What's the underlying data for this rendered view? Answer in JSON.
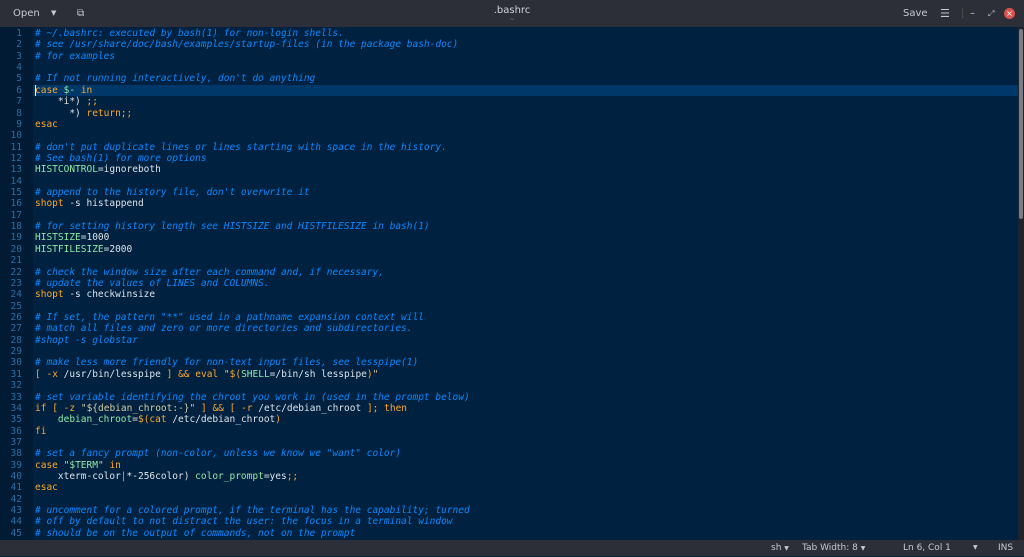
{
  "header": {
    "open_label": "Open",
    "title": ".bashrc",
    "subtitle": "~",
    "save_label": "Save"
  },
  "status": {
    "language": "sh",
    "tab_width": "Tab Width: 8",
    "position": "Ln 6, Col 1",
    "mode": "INS"
  },
  "editor": {
    "current_line": 6,
    "lines": [
      [
        [
          "c",
          "# ~/.bashrc: executed by bash(1) for non-login shells."
        ]
      ],
      [
        [
          "c",
          "# see /usr/share/doc/bash/examples/startup-files (in the package bash-doc)"
        ]
      ],
      [
        [
          "c",
          "# for examples"
        ]
      ],
      [],
      [
        [
          "c",
          "# If not running interactively, don't do anything"
        ]
      ],
      [
        [
          "k",
          "case"
        ],
        [
          "t",
          " "
        ],
        [
          "v",
          "$-"
        ],
        [
          "t",
          " "
        ],
        [
          "k",
          "in"
        ]
      ],
      [
        [
          "t",
          "    *i*) "
        ],
        [
          "k",
          ";;"
        ]
      ],
      [
        [
          "t",
          "      *) "
        ],
        [
          "k",
          "return;;"
        ]
      ],
      [
        [
          "k",
          "esac"
        ]
      ],
      [],
      [
        [
          "c",
          "# don't put duplicate lines or lines starting with space in the history."
        ]
      ],
      [
        [
          "c",
          "# See bash(1) for more options"
        ]
      ],
      [
        [
          "v",
          "HISTCONTROL"
        ],
        [
          "t",
          "=ignoreboth"
        ]
      ],
      [],
      [
        [
          "c",
          "# append to the history file, don't overwrite it"
        ]
      ],
      [
        [
          "k",
          "shopt"
        ],
        [
          "t",
          " -s histappend"
        ]
      ],
      [],
      [
        [
          "c",
          "# for setting history length see HISTSIZE and HISTFILESIZE in bash(1)"
        ]
      ],
      [
        [
          "v",
          "HISTSIZE"
        ],
        [
          "t",
          "=1000"
        ]
      ],
      [
        [
          "v",
          "HISTFILESIZE"
        ],
        [
          "t",
          "=2000"
        ]
      ],
      [],
      [
        [
          "c",
          "# check the window size after each command and, if necessary,"
        ]
      ],
      [
        [
          "c",
          "# update the values of LINES and COLUMNS."
        ]
      ],
      [
        [
          "k",
          "shopt"
        ],
        [
          "t",
          " -s checkwinsize"
        ]
      ],
      [],
      [
        [
          "c",
          "# If set, the pattern \"**\" used in a pathname expansion context will"
        ]
      ],
      [
        [
          "c",
          "# match all files and zero or more directories and subdirectories."
        ]
      ],
      [
        [
          "c",
          "#shopt -s globstar"
        ]
      ],
      [],
      [
        [
          "c",
          "# make less more friendly for non-text input files, see lesspipe(1)"
        ]
      ],
      [
        [
          "k",
          "["
        ],
        [
          "t",
          " "
        ],
        [
          "k",
          "-x"
        ],
        [
          "t",
          " /usr/bin/lesspipe "
        ],
        [
          "k",
          "]"
        ],
        [
          "t",
          " "
        ],
        [
          "k",
          "&&"
        ],
        [
          "t",
          " "
        ],
        [
          "k",
          "eval"
        ],
        [
          "t",
          " "
        ],
        [
          "s",
          "\""
        ],
        [
          "k",
          "$("
        ],
        [
          "v",
          "SHELL"
        ],
        [
          "t",
          "=/bin/sh lesspipe"
        ],
        [
          "k",
          ")"
        ],
        [
          "s",
          "\""
        ]
      ],
      [],
      [
        [
          "c",
          "# set variable identifying the chroot you work in (used in the prompt below)"
        ]
      ],
      [
        [
          "k",
          "if"
        ],
        [
          "t",
          " "
        ],
        [
          "k",
          "["
        ],
        [
          "t",
          " "
        ],
        [
          "k",
          "-z"
        ],
        [
          "t",
          " "
        ],
        [
          "s",
          "\"${debian_chroot:-}\""
        ],
        [
          "t",
          " "
        ],
        [
          "k",
          "]"
        ],
        [
          "t",
          " "
        ],
        [
          "k",
          "&&"
        ],
        [
          "t",
          " "
        ],
        [
          "k",
          "["
        ],
        [
          "t",
          " "
        ],
        [
          "k",
          "-r"
        ],
        [
          "t",
          " /etc/debian_chroot "
        ],
        [
          "k",
          "];"
        ],
        [
          "t",
          " "
        ],
        [
          "k",
          "then"
        ]
      ],
      [
        [
          "t",
          "    "
        ],
        [
          "v",
          "debian_chroot"
        ],
        [
          "t",
          "="
        ],
        [
          "k",
          "$(cat"
        ],
        [
          "t",
          " /etc/debian_chroot"
        ],
        [
          "k",
          ")"
        ]
      ],
      [
        [
          "k",
          "fi"
        ]
      ],
      [],
      [
        [
          "c",
          "# set a fancy prompt (non-color, unless we know we \"want\" color)"
        ]
      ],
      [
        [
          "k",
          "case"
        ],
        [
          "t",
          " "
        ],
        [
          "s",
          "\""
        ],
        [
          "v",
          "$TERM"
        ],
        [
          "s",
          "\""
        ],
        [
          "t",
          " "
        ],
        [
          "k",
          "in"
        ]
      ],
      [
        [
          "t",
          "    xterm-color"
        ],
        [
          "k",
          "|"
        ],
        [
          "t",
          "*-256color) "
        ],
        [
          "v",
          "color_prompt"
        ],
        [
          "t",
          "=yes"
        ],
        [
          "k",
          ";;"
        ]
      ],
      [
        [
          "k",
          "esac"
        ]
      ],
      [],
      [
        [
          "c",
          "# uncomment for a colored prompt, if the terminal has the capability; turned"
        ]
      ],
      [
        [
          "c",
          "# off by default to not distract the user: the focus in a terminal window"
        ]
      ],
      [
        [
          "c",
          "# should be on the output of commands, not on the prompt"
        ]
      ]
    ]
  }
}
